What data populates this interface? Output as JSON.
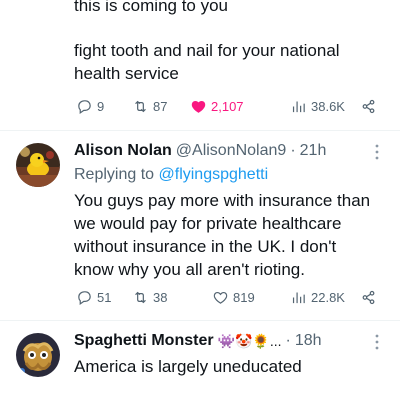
{
  "tweet1": {
    "lines": [
      "this is coming to you",
      "fight tooth and nail for your national",
      "health service"
    ],
    "replies": "9",
    "retweets": "87",
    "likes": "2,107",
    "views": "38.6K"
  },
  "tweet2": {
    "name": "Alison Nolan",
    "handle": "@AlisonNolan9",
    "time": "21h",
    "replying_prefix": "Replying to",
    "replying_to": "@flyingspghetti",
    "lines": [
      "You guys pay more with insurance than",
      "we would pay for private healthcare",
      "without insurance in the UK. I don't",
      "know why you all aren't rioting."
    ],
    "replies": "51",
    "retweets": "38",
    "likes": "819",
    "views": "22.8K"
  },
  "tweet3": {
    "name": "Spaghetti Monster",
    "badges": "👾🤡🌻...",
    "time": "18h",
    "lines": [
      "America is largely uneducated"
    ]
  },
  "colors": {
    "accent": "#1d9bf0",
    "like": "#f91880",
    "muted": "#536471"
  },
  "icons": [
    "reply-icon",
    "retweet-icon",
    "like-icon",
    "views-icon",
    "share-icon",
    "more-icon"
  ]
}
